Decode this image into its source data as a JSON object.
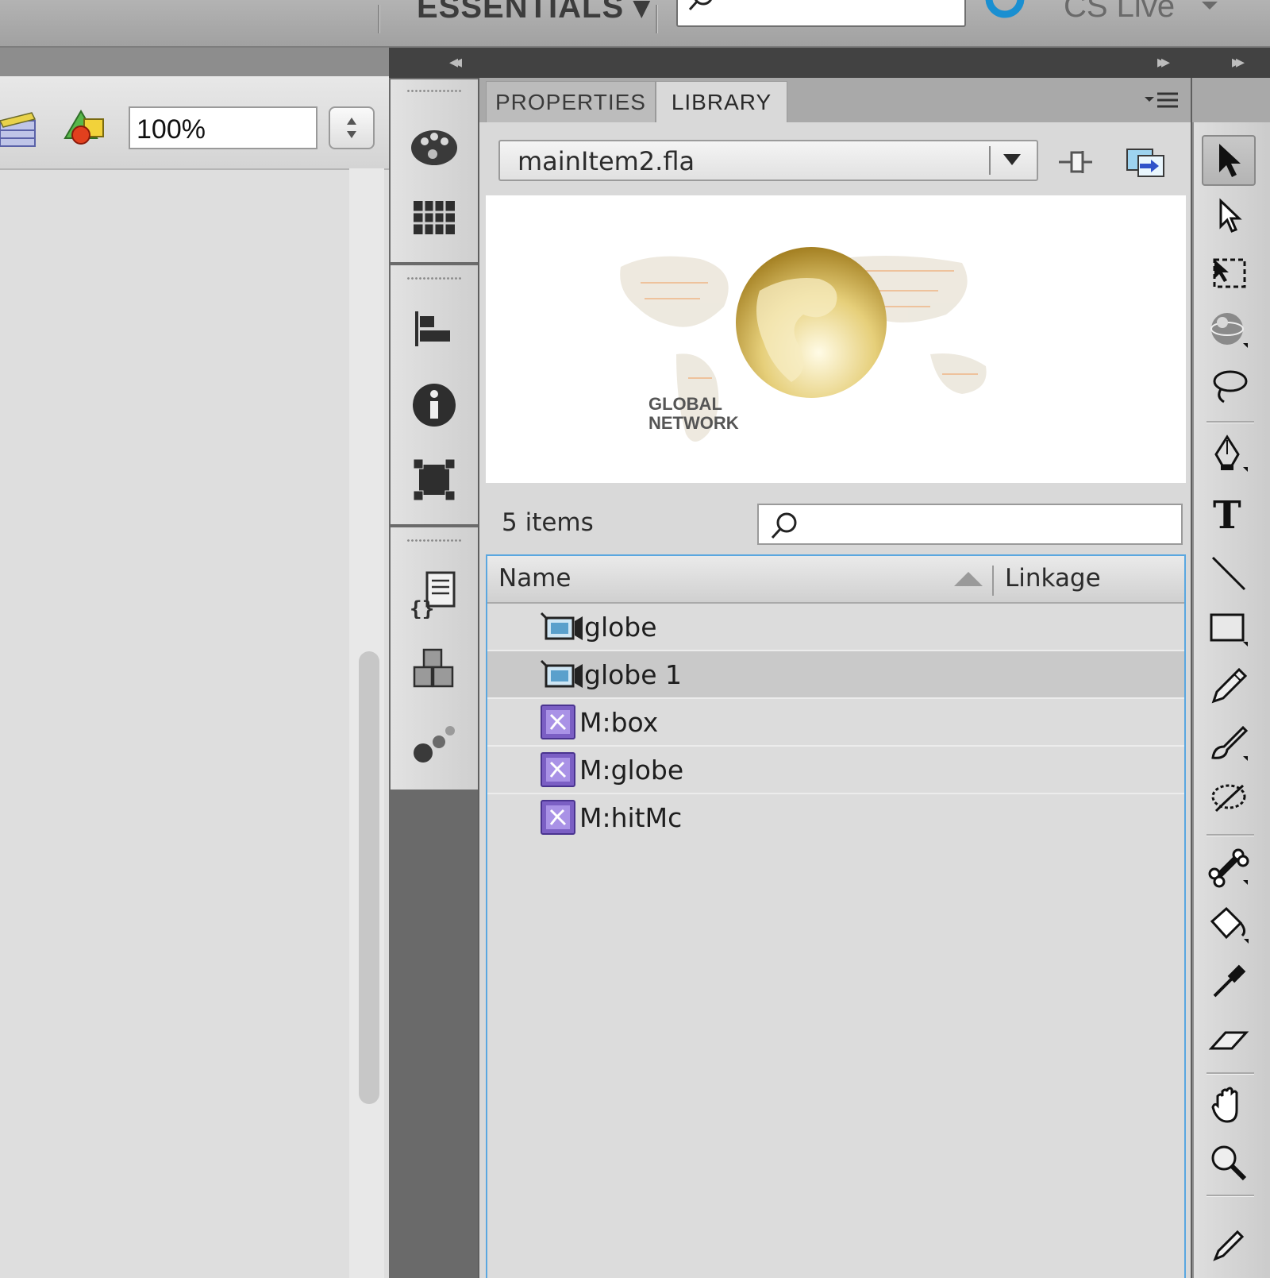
{
  "app_bar": {
    "workspace": "ESSENTIALS ▾",
    "cs_live": "CS Live"
  },
  "stage_toolbar": {
    "zoom": "100%"
  },
  "panel_tabs": {
    "properties": "PROPERTIES",
    "library": "LIBRARY"
  },
  "library": {
    "document": "mainItem2.fla",
    "preview_text_line1": "GLOBAL",
    "preview_text_line2": "NETWORK",
    "item_count": "5 items",
    "search_value": "",
    "columns": {
      "name": "Name",
      "linkage": "Linkage"
    },
    "items": [
      {
        "name": "globe",
        "type": "video-icon",
        "selected": false
      },
      {
        "name": "globe 1",
        "type": "video-icon",
        "selected": true
      },
      {
        "name": "M:box",
        "type": "movieclip-icon",
        "selected": false
      },
      {
        "name": "M:globe",
        "type": "movieclip-icon",
        "selected": false
      },
      {
        "name": "M:hitMc",
        "type": "movieclip-icon",
        "selected": false
      }
    ]
  },
  "colors": {
    "selection_row": "#c9c9c9",
    "list_focus_border": "#5aa7e0",
    "movieclip_icon": "#7b5fc4",
    "cs_live_accent": "#1a8fd1"
  }
}
